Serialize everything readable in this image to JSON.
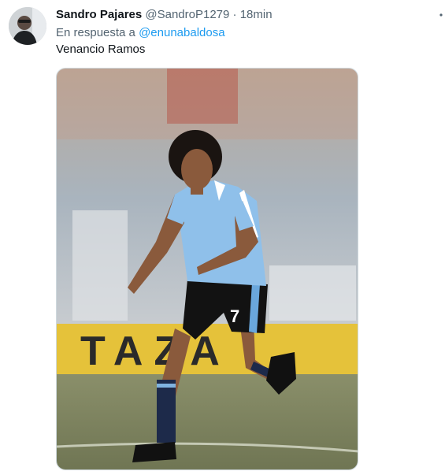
{
  "tweet": {
    "author": {
      "display_name": "Sandro Pajares",
      "handle": "@SandroP1279"
    },
    "separator": "·",
    "timestamp": "18min",
    "more_icon": "more-dots-icon",
    "reply_to": {
      "prefix": "En respuesta a",
      "mention": "@enunabaldosa"
    },
    "text": "Venancio Ramos",
    "media": {
      "kind": "photo",
      "banner_text": "TAZA",
      "shirt_number": "7"
    }
  },
  "colors": {
    "link": "#1d9bf0",
    "secondary_text": "#536471",
    "primary_text": "#0f1419"
  }
}
